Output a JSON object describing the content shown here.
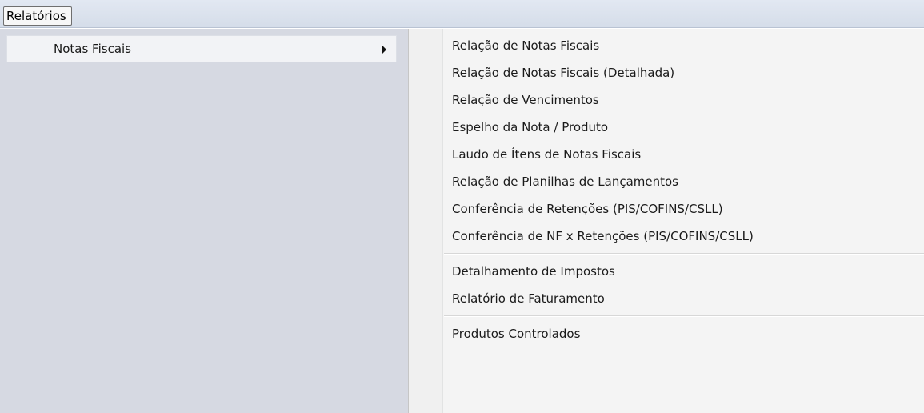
{
  "menubar": {
    "items": [
      {
        "label": "Relatórios"
      }
    ]
  },
  "submenu": {
    "items": [
      {
        "label": "Notas Fiscais",
        "has_submenu": true
      }
    ]
  },
  "flyout": {
    "groups": [
      [
        "Relação de Notas Fiscais",
        "Relação de Notas Fiscais (Detalhada)",
        "Relação de Vencimentos",
        "Espelho da Nota / Produto",
        "Laudo de Ítens de Notas Fiscais",
        "Relação de Planilhas de Lançamentos",
        "Conferência de Retenções (PIS/COFINS/CSLL)",
        "Conferência de NF x Retenções (PIS/COFINS/CSLL)"
      ],
      [
        "Detalhamento de Impostos",
        "Relatório de Faturamento"
      ],
      [
        "Produtos Controlados"
      ]
    ]
  }
}
